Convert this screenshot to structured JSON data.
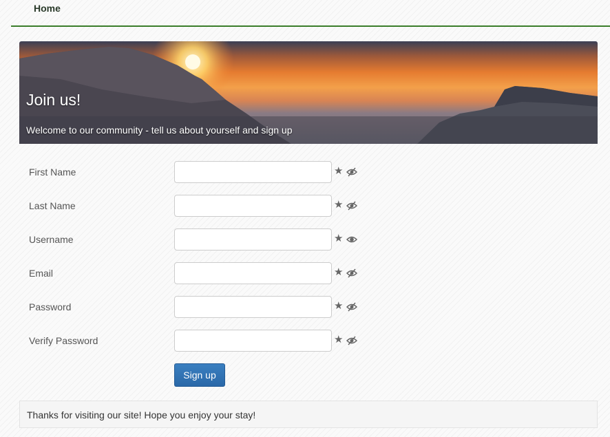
{
  "nav": {
    "home": "Home"
  },
  "hero": {
    "title": "Join us!",
    "subtitle": "Welcome to our community - tell us about yourself and sign up"
  },
  "form": {
    "fields": [
      {
        "label": "First Name",
        "value": "",
        "eye": "eye-slash-icon"
      },
      {
        "label": "Last Name",
        "value": "",
        "eye": "eye-slash-icon"
      },
      {
        "label": "Username",
        "value": "",
        "eye": "eye-icon"
      },
      {
        "label": "Email",
        "value": "",
        "eye": "eye-slash-icon"
      },
      {
        "label": "Password",
        "value": "",
        "eye": "eye-slash-icon"
      },
      {
        "label": "Verify Password",
        "value": "",
        "eye": "eye-slash-icon"
      }
    ],
    "submit": "Sign up"
  },
  "footer": {
    "text": "Thanks for visiting our site! Hope you enjoy your stay!"
  },
  "colors": {
    "nav_rule": "#3a7d2a",
    "button": "#2a68a8"
  }
}
